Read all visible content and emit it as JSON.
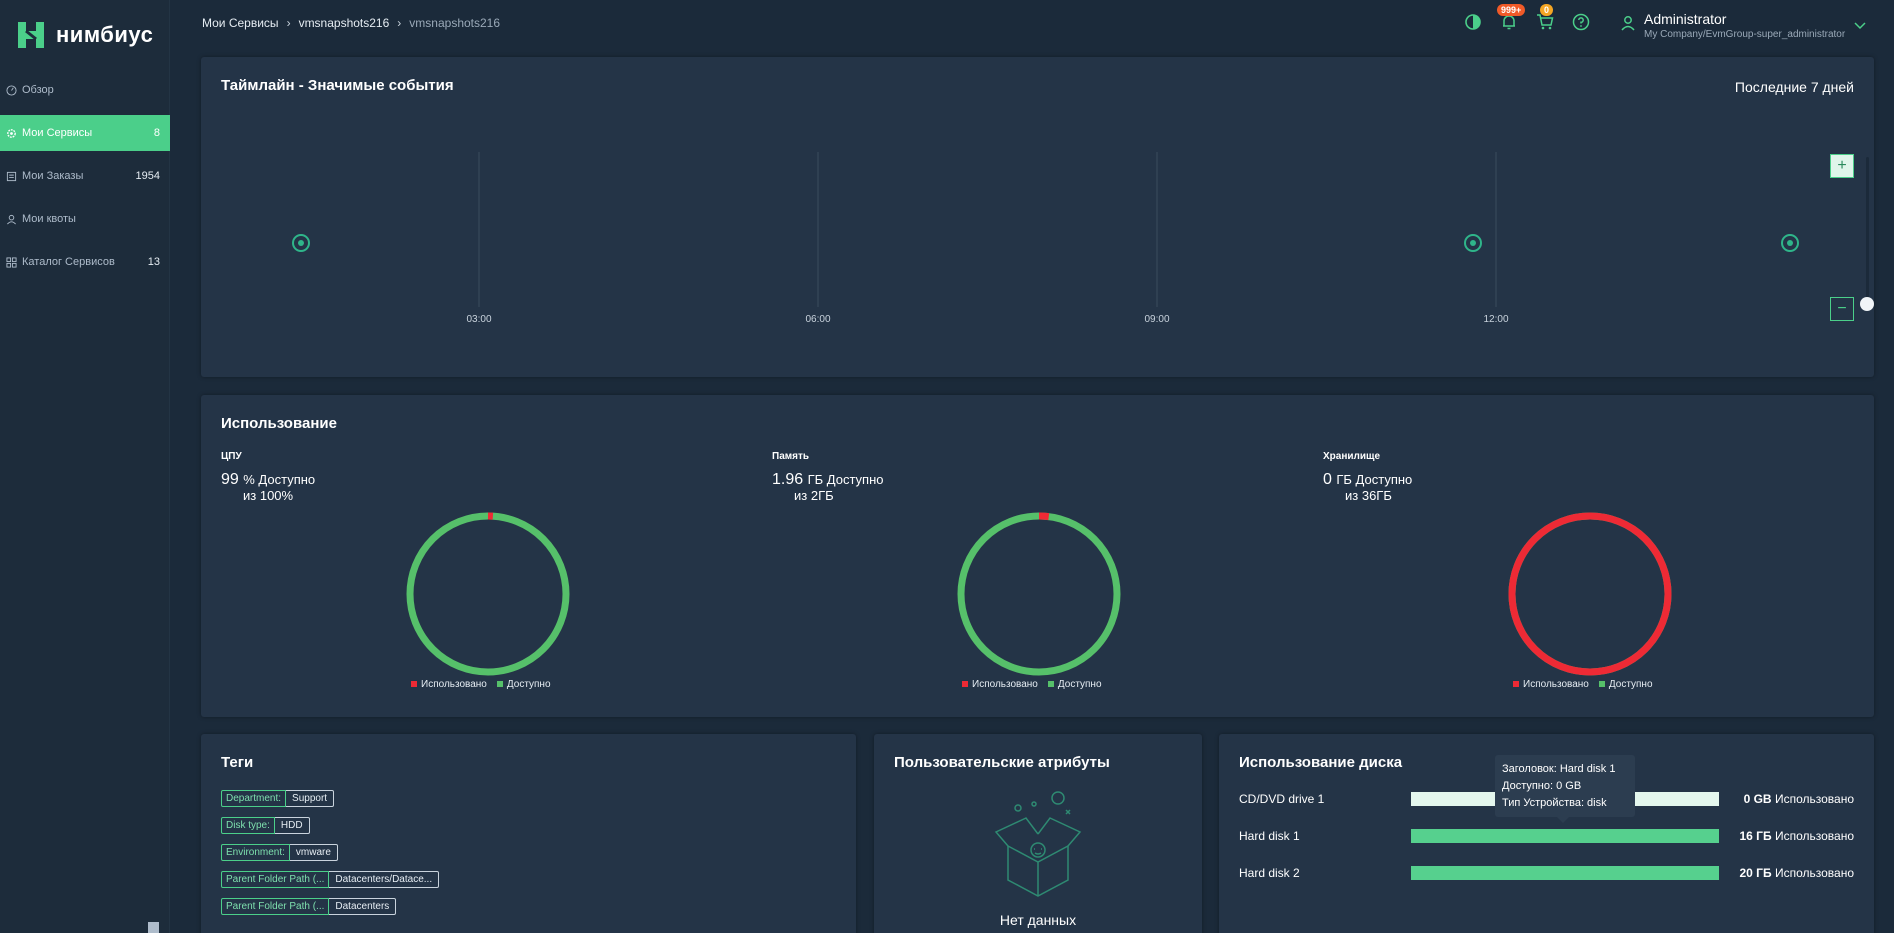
{
  "app": {
    "logo_text": "нимбиус",
    "brand_color": "#4bcf8a"
  },
  "sidebar": {
    "items": [
      {
        "label": "Обзор",
        "count": "",
        "icon": "dashboard-icon"
      },
      {
        "label": "Мои Сервисы",
        "count": "8",
        "icon": "gear-icon"
      },
      {
        "label": "Мои Заказы",
        "count": "1954",
        "icon": "list-icon"
      },
      {
        "label": "Мои квоты",
        "count": "",
        "icon": "user-icon"
      },
      {
        "label": "Каталог Сервисов",
        "count": "13",
        "icon": "grid-icon"
      }
    ]
  },
  "header": {
    "breadcrumb": [
      "Мои Сервисы",
      "vmsnapshots216",
      "vmsnapshots216"
    ],
    "notifications_badge": "999+",
    "cart_badge": "0",
    "user_name": "Administrator",
    "user_group": "My Company/EvmGroup-super_administrator"
  },
  "timeline": {
    "title": "Таймлайн - Значимые события",
    "range": "Последние 7 дней",
    "ticks": [
      "03:00",
      "06:00",
      "09:00",
      "12:00"
    ],
    "zoom_in": "+",
    "zoom_out": "−"
  },
  "usage": {
    "title": "Использование",
    "metrics": [
      {
        "title": "ЦПУ",
        "value": "99",
        "unit": "% Доступно",
        "of": "из 100%",
        "used_fraction": 0.01
      },
      {
        "title": "Память",
        "value": "1.96",
        "unit": "ГБ Доступно",
        "of": "из 2ГБ",
        "used_fraction": 0.02
      },
      {
        "title": "Хранилище",
        "value": "0",
        "unit": "ГБ Доступно",
        "of": "из 36ГБ",
        "used_fraction": 1.0
      }
    ],
    "legend_used": "Использовано",
    "legend_available": "Доступно",
    "color_used": "#ee2a35",
    "color_available": "#56c06a"
  },
  "tags": {
    "title": "Теги",
    "items": [
      {
        "key": "Department:",
        "value": "Support"
      },
      {
        "key": "Disk type:",
        "value": "HDD"
      },
      {
        "key": "Environment:",
        "value": "vmware"
      },
      {
        "key": "Parent Folder Path (...",
        "value": "Datacenters/Datace..."
      },
      {
        "key": "Parent Folder Path (...",
        "value": "Datacenters"
      }
    ]
  },
  "attributes": {
    "title": "Пользовательские атрибуты",
    "empty": "Нет данных"
  },
  "disk": {
    "title": "Использование диска",
    "rows": [
      {
        "name": "CD/DVD drive 1",
        "amount": "0 GB",
        "suffix": "Использовано",
        "fill": "light"
      },
      {
        "name": "Hard disk 1",
        "amount": "16 ГБ",
        "suffix": "Использовано",
        "fill": "green"
      },
      {
        "name": "Hard disk 2",
        "amount": "20 ГБ",
        "suffix": "Использовано",
        "fill": "green"
      }
    ],
    "tooltip": {
      "line1": "Заголовок: Hard disk 1",
      "line2": "Доступно: 0 GB",
      "line3": "Тип Устройства: disk"
    }
  }
}
